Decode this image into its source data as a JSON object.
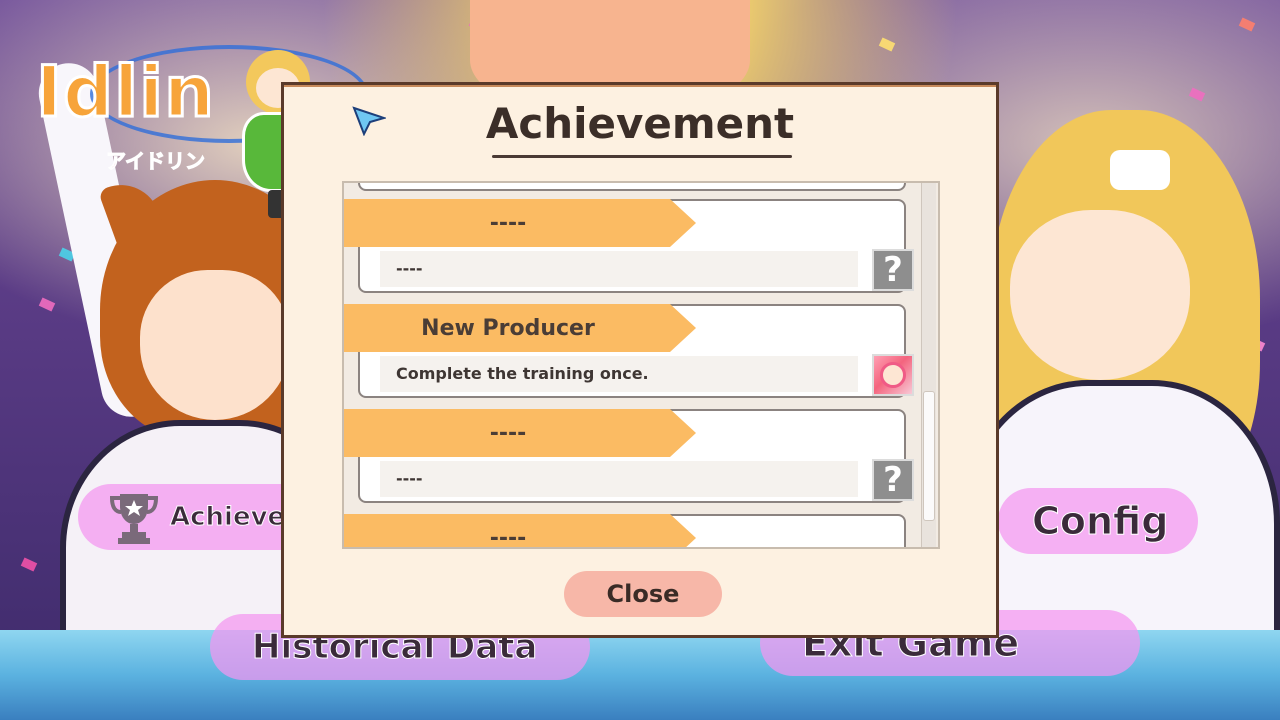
{
  "logo": {
    "title": "Idlin",
    "subtitle": "アイドリン"
  },
  "menu": {
    "achievement_label": "Achiever",
    "config_label": "Config",
    "historical_label": "Historical Data",
    "exit_label": "Exit Game"
  },
  "dialog": {
    "title": "Achievement",
    "entries": [
      {
        "name": "----",
        "description": "----",
        "icon": "question-mark-icon"
      },
      {
        "name": "New Producer",
        "description": "Complete the training once.",
        "icon": "character-portrait-icon"
      },
      {
        "name": "----",
        "description": "----",
        "icon": "question-mark-icon"
      },
      {
        "name": "----",
        "description": "",
        "icon": ""
      }
    ],
    "locked_icon_glyph": "?",
    "close_label": "Close"
  },
  "colors": {
    "banner": "#fbbb63",
    "dialog_bg": "#fdf1e1",
    "close_button": "#f7b7a8",
    "menu_button": "#f496f0"
  }
}
